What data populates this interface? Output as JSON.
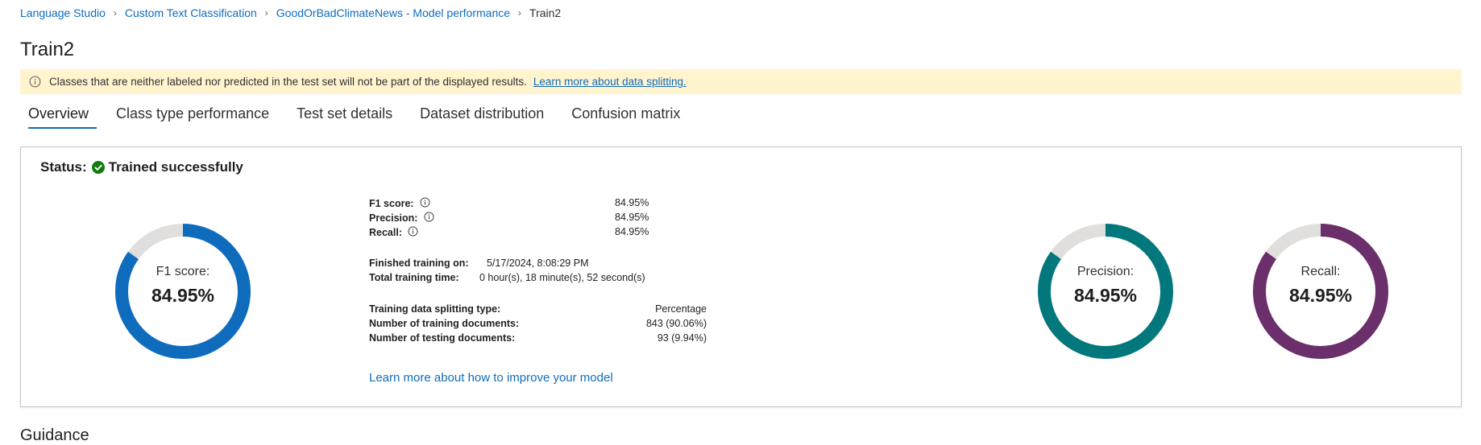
{
  "breadcrumb": {
    "items": [
      "Language Studio",
      "Custom Text Classification",
      "GoodOrBadClimateNews - Model performance"
    ],
    "current": "Train2"
  },
  "page": {
    "title": "Train2"
  },
  "banner": {
    "text": "Classes that are neither labeled nor predicted in the test set will not be part of the displayed results.",
    "link": "Learn more about data splitting."
  },
  "tabs": [
    {
      "label": "Overview",
      "active": true
    },
    {
      "label": "Class type performance",
      "active": false
    },
    {
      "label": "Test set details",
      "active": false
    },
    {
      "label": "Dataset distribution",
      "active": false
    },
    {
      "label": "Confusion matrix",
      "active": false
    }
  ],
  "status": {
    "label": "Status:",
    "value": "Trained successfully"
  },
  "donuts": {
    "f1": {
      "label": "F1 score:",
      "value": "84.95%",
      "fraction": 0.8495,
      "color": "#0f6cbd"
    },
    "precision": {
      "label": "Precision:",
      "value": "84.95%",
      "fraction": 0.8495,
      "color": "#03787c"
    },
    "recall": {
      "label": "Recall:",
      "value": "84.95%",
      "fraction": 0.8495,
      "color": "#6b2f6b"
    }
  },
  "metrics": {
    "f1_label": "F1 score:",
    "f1_value": "84.95%",
    "precision_label": "Precision:",
    "precision_value": "84.95%",
    "recall_label": "Recall:",
    "recall_value": "84.95%",
    "finished_label": "Finished training on:",
    "finished_value": "5/17/2024, 8:08:29 PM",
    "total_label": "Total training time:",
    "total_value": "0 hour(s), 18 minute(s), 52 second(s)",
    "split_label": "Training data splitting type:",
    "split_value": "Percentage",
    "train_docs_label": "Number of training documents:",
    "train_docs_value": "843 (90.06%)",
    "test_docs_label": "Number of testing documents:",
    "test_docs_value": "93 (9.94%)"
  },
  "improve_link": "Learn more about how to improve your model",
  "guidance_title": "Guidance",
  "colors": {
    "accent": "#0f6cbd",
    "success": "#107c10",
    "banner_bg": "#fff4ce",
    "track": "#e1dfdd"
  }
}
